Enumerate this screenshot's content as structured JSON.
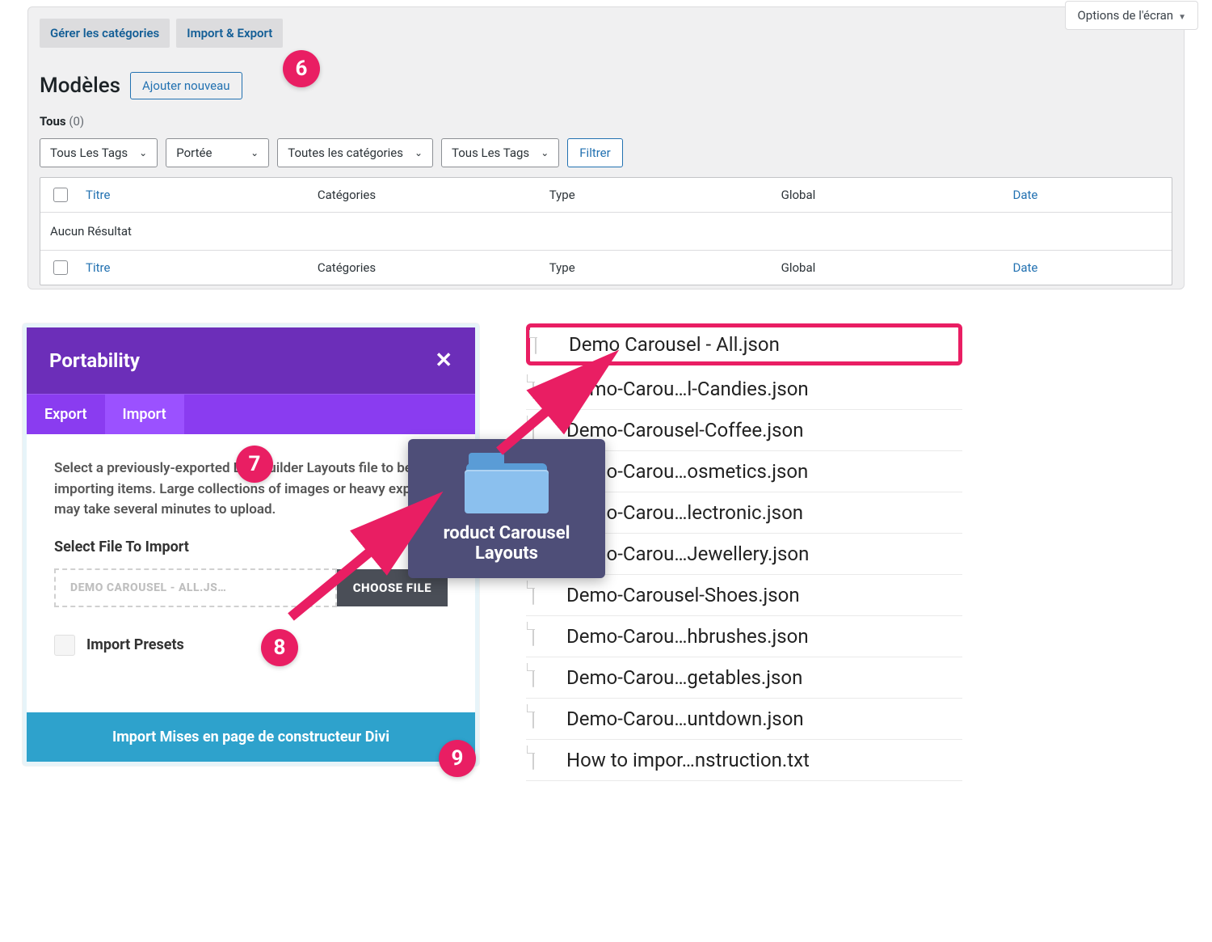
{
  "screen_options": "Options de l'écran",
  "tabs": {
    "manage": "Gérer les catégories",
    "import_export": "Import & Export"
  },
  "page_title": "Modèles",
  "add_new": "Ajouter nouveau",
  "all_label": "Tous",
  "all_count": "(0)",
  "filters": {
    "f1": "Tous Les Tags",
    "f2": "Portée",
    "f3": "Toutes les catégories",
    "f4": "Tous Les Tags",
    "btn": "Filtrer"
  },
  "columns": {
    "title": "Titre",
    "cat": "Catégories",
    "type": "Type",
    "global": "Global",
    "date": "Date"
  },
  "no_result": "Aucun Résultat",
  "badges": {
    "b6": "6",
    "b7": "7",
    "b8": "8",
    "b9": "9"
  },
  "modal": {
    "title": "Portability",
    "tab_export": "Export",
    "tab_import": "Import",
    "desc": "Select a previously-exported Divi Builder Layouts file to begin importing items. Large collections of images or heavy exports may take several minutes to upload.",
    "select_label": "Select File To Import",
    "file_name": "DEMO CAROUSEL - ALL.JS…",
    "choose": "CHOOSE FILE",
    "preset": "Import Presets",
    "import_btn": "Import Mises en page de constructeur Divi"
  },
  "folder_name": "roduct Carousel Layouts",
  "files": {
    "f1": "Demo Carousel - All.json",
    "f2": "Demo-Carou…l-Candies.json",
    "f3": "Demo-Carousel-Coffee.json",
    "f4": "Demo-Carou…osmetics.json",
    "f5": "Demo-Carou…lectronic.json",
    "f6": "Demo-Carou…Jewellery.json",
    "f7": "Demo-Carousel-Shoes.json",
    "f8": "Demo-Carou…hbrushes.json",
    "f9": "Demo-Carou…getables.json",
    "f10": "Demo-Carou…untdown.json",
    "f11": "How to impor…nstruction.txt"
  }
}
